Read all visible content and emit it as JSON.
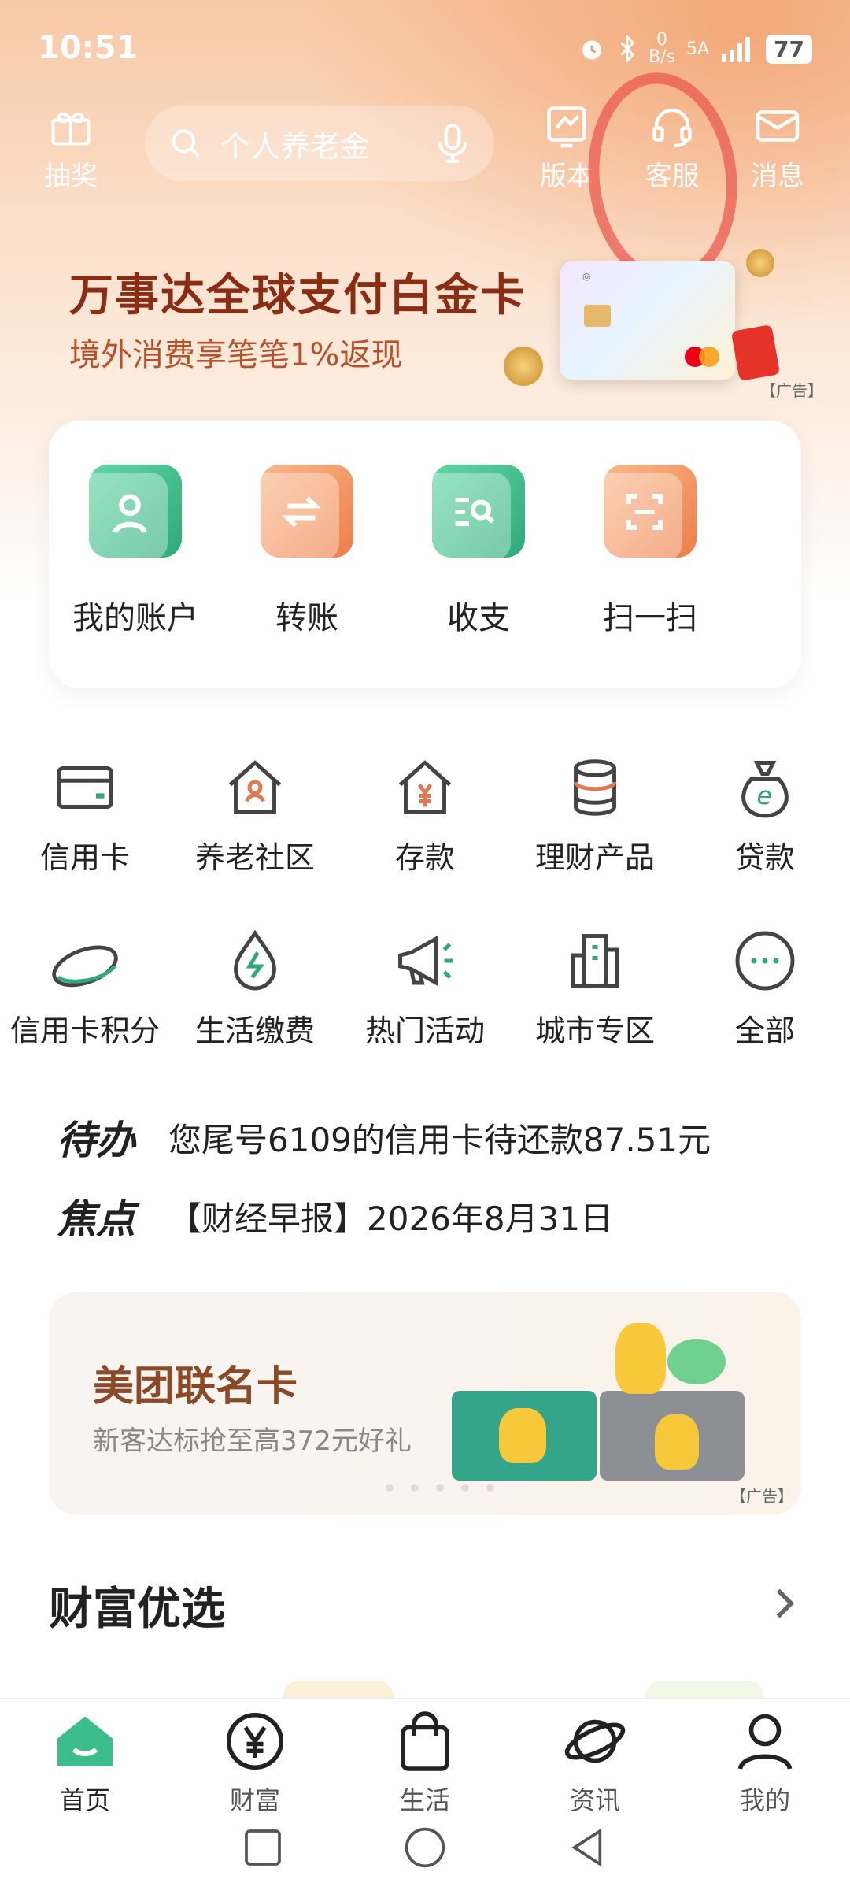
{
  "status_bar": {
    "time": "10:51",
    "net_speed_value": "0",
    "net_speed_unit": "B/s",
    "signal_label": "5A",
    "battery": "77"
  },
  "header": {
    "lottery_label": "抽奖",
    "search_placeholder": "个人养老金",
    "version_label": "版本",
    "service_label": "客服",
    "message_label": "消息"
  },
  "ad_banner": {
    "title": "万事达全球支付白金卡",
    "subtitle": "境外消费享笔笔1%返现",
    "ad_tag": "【广告】"
  },
  "quick_actions": [
    {
      "label": "我的账户",
      "icon": "account-icon",
      "color": "#3bbd8c"
    },
    {
      "label": "转账",
      "icon": "transfer-icon",
      "color": "#f08a55"
    },
    {
      "label": "收支",
      "icon": "statement-icon",
      "color": "#3bbd8c"
    },
    {
      "label": "扫一扫",
      "icon": "scan-icon",
      "color": "#f08a55"
    }
  ],
  "services_row1": [
    {
      "label": "信用卡",
      "icon": "credit-card-icon"
    },
    {
      "label": "养老社区",
      "icon": "elder-community-icon"
    },
    {
      "label": "存款",
      "icon": "deposit-icon"
    },
    {
      "label": "理财产品",
      "icon": "wealth-product-icon"
    },
    {
      "label": "贷款",
      "icon": "loan-icon"
    }
  ],
  "services_row2": [
    {
      "label": "信用卡积分",
      "icon": "card-points-icon"
    },
    {
      "label": "生活缴费",
      "icon": "utility-pay-icon"
    },
    {
      "label": "热门活动",
      "icon": "megaphone-icon"
    },
    {
      "label": "城市专区",
      "icon": "city-icon"
    },
    {
      "label": "全部",
      "icon": "more-icon"
    }
  ],
  "todo": {
    "tag": "待办",
    "text": "您尾号6109的信用卡待还款87.51元"
  },
  "focus": {
    "tag": "焦点",
    "text": "【财经早报】2026年8月31日"
  },
  "meituan_banner": {
    "title": "美团联名卡",
    "subtitle": "新客达标抢至高372元好礼",
    "ad_tag": "【广告】"
  },
  "wealth_section": {
    "title": "财富优选"
  },
  "bottom_nav": [
    {
      "label": "首页",
      "icon": "home-icon",
      "active": true
    },
    {
      "label": "财富",
      "icon": "yuan-icon",
      "active": false
    },
    {
      "label": "生活",
      "icon": "shopping-bag-icon",
      "active": false
    },
    {
      "label": "资讯",
      "icon": "planet-icon",
      "active": false
    },
    {
      "label": "我的",
      "icon": "person-icon",
      "active": false
    }
  ],
  "colors": {
    "brand_green": "#3bbd8c",
    "accent_orange": "#f08a55",
    "banner_title": "#8a2d14"
  }
}
